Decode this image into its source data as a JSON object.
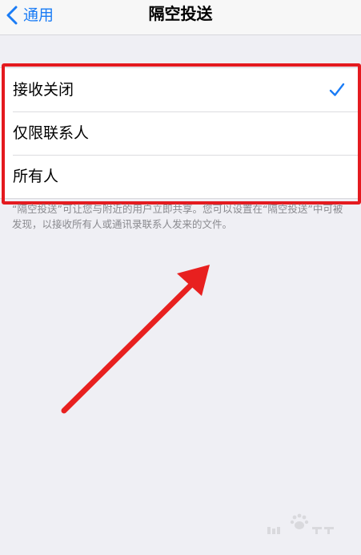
{
  "navbar": {
    "back_label": "通用",
    "title": "隔空投送"
  },
  "options": [
    {
      "label": "接收关闭",
      "selected": true
    },
    {
      "label": "仅限联系人",
      "selected": false
    },
    {
      "label": "所有人",
      "selected": false
    }
  ],
  "footer": {
    "description": "“隔空投送”可让您与附近的用户立即共享。您可以设置在“隔空投送”中可被发现，以接收所有人或通讯录联系人发来的文件。"
  },
  "colors": {
    "accent": "#1a7cf6",
    "highlight": "#e41a1f",
    "background": "#efeff4"
  },
  "icons": {
    "back": "chevron-left-icon",
    "selected": "checkmark-icon",
    "annotation": "arrow-icon"
  }
}
